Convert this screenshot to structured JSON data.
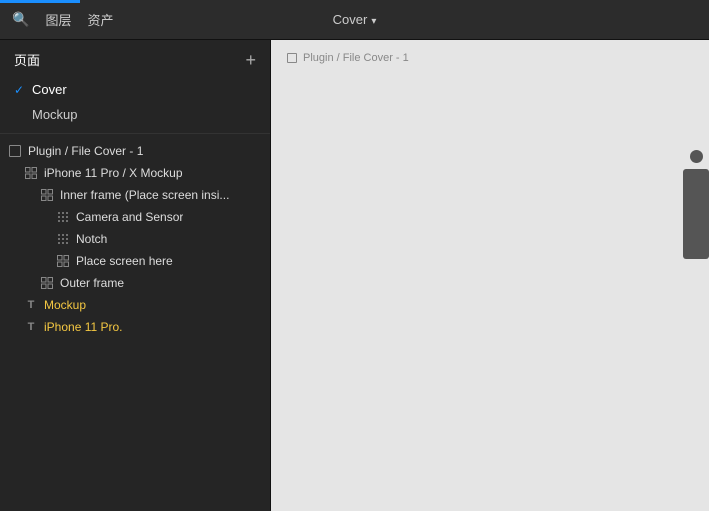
{
  "topbar": {
    "search_icon": "🔍",
    "nav_layers": "图层",
    "nav_assets": "资产",
    "title": "Cover",
    "caret": "▾"
  },
  "sidebar": {
    "pages_label": "页面",
    "add_icon": "+",
    "pages": [
      {
        "id": "cover",
        "label": "Cover",
        "active": true,
        "checked": true
      },
      {
        "id": "mockup",
        "label": "Mockup",
        "active": false,
        "checked": false
      }
    ]
  },
  "layers": [
    {
      "id": "plugin-file-cover",
      "label": "Plugin / File Cover - 1",
      "icon_type": "frame",
      "indent": 0
    },
    {
      "id": "iphone-11-pro",
      "label": "iPhone 11 Pro / X Mockup",
      "icon_type": "component_grid",
      "indent": 1
    },
    {
      "id": "inner-frame",
      "label": "Inner frame (Place screen insi...",
      "icon_type": "component_grid",
      "indent": 2
    },
    {
      "id": "camera-sensor",
      "label": "Camera and Sensor",
      "icon_type": "dots_grid",
      "indent": 3
    },
    {
      "id": "notch",
      "label": "Notch",
      "icon_type": "dots_grid",
      "indent": 3
    },
    {
      "id": "place-screen",
      "label": "Place screen here",
      "icon_type": "component_grid",
      "indent": 3
    },
    {
      "id": "outer-frame",
      "label": "Outer frame",
      "icon_type": "component_grid",
      "indent": 2
    },
    {
      "id": "mockup-text",
      "label": "Mockup",
      "icon_type": "text",
      "indent": 1,
      "color": "yellow"
    },
    {
      "id": "iphone-11-pro-text",
      "label": "iPhone 11 Pro.",
      "icon_type": "text",
      "indent": 1,
      "color": "yellow"
    }
  ],
  "canvas": {
    "label": "Plugin / File Cover - 1"
  }
}
